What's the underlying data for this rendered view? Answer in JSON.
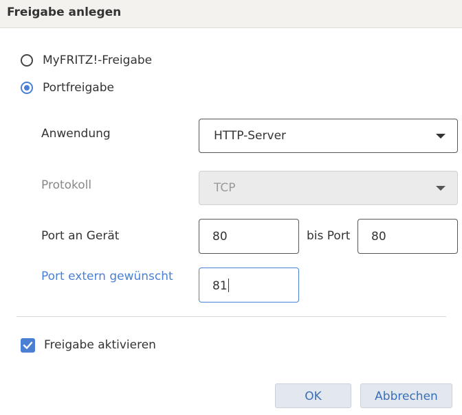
{
  "dialog": {
    "title": "Freigabe anlegen"
  },
  "share_type": {
    "options": [
      {
        "label": "MyFRITZ!-Freigabe",
        "selected": false
      },
      {
        "label": "Portfreigabe",
        "selected": true
      }
    ]
  },
  "form": {
    "application": {
      "label": "Anwendung",
      "value": "HTTP-Server"
    },
    "protocol": {
      "label": "Protokoll",
      "value": "TCP",
      "disabled": true
    },
    "port_device": {
      "label": "Port an Gerät",
      "from_value": "80",
      "to_label": "bis Port",
      "to_value": "80"
    },
    "port_external": {
      "label": "Port extern gewünscht",
      "value": "81"
    }
  },
  "activate": {
    "label": "Freigabe aktivieren",
    "checked": true
  },
  "buttons": {
    "ok_label": "OK",
    "cancel_label": "Abbrechen"
  },
  "colors": {
    "accent": "#4a7fd4",
    "titlebar_bg": "#f3f2ee",
    "button_bg": "#e3e8ef",
    "button_text": "#3a6fb8"
  },
  "icons": {
    "dropdown": "chevron-down-icon",
    "check": "check-icon"
  }
}
